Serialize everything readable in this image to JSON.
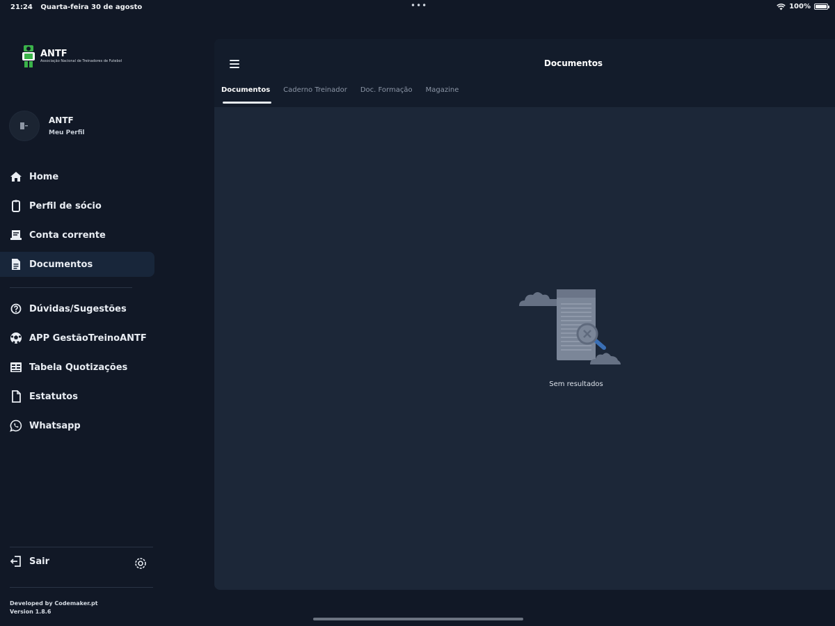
{
  "status_bar": {
    "time": "21:24",
    "date": "Quarta-feira 30 de agosto",
    "dots": "•••",
    "battery_pct": "100%",
    "icons": [
      "wifi-icon",
      "battery-icon"
    ]
  },
  "sidebar": {
    "logo": {
      "title": "ANTF",
      "subtitle": "Associação Nacional de Treinadores de Futebol"
    },
    "profile": {
      "name": "ANTF",
      "link": "Meu Perfil"
    },
    "menu": [
      {
        "label": "Home",
        "icon": "home-icon",
        "active": false
      },
      {
        "label": "Perfil de sócio",
        "icon": "member-card-icon",
        "active": false
      },
      {
        "label": "Conta corrente",
        "icon": "receipt-icon",
        "active": false
      },
      {
        "label": "Documentos",
        "icon": "document-icon",
        "active": true
      }
    ],
    "menu2": [
      {
        "label": "Dúvidas/Sugestões",
        "icon": "help-icon"
      },
      {
        "label": "APP GestãoTreinoANTF",
        "icon": "soccer-ball-icon"
      },
      {
        "label": "Tabela Quotizações",
        "icon": "table-icon"
      },
      {
        "label": "Estatutos",
        "icon": "file-icon"
      },
      {
        "label": "Whatsapp",
        "icon": "whatsapp-icon"
      }
    ],
    "logout_label": "Sair",
    "developer": "Developed by Codemaker.pt",
    "version": "Version 1.8.6"
  },
  "main": {
    "title": "Documentos",
    "tabs": [
      {
        "label": "Documentos",
        "active": true
      },
      {
        "label": "Caderno Treinador",
        "active": false
      },
      {
        "label": "Doc. Formação",
        "active": false
      },
      {
        "label": "Magazine",
        "active": false
      }
    ],
    "empty_state": "Sem resultados"
  },
  "colors": {
    "background": "#111826",
    "panel": "#1c2738",
    "topbar": "#131c2b",
    "active_item": "#18263a",
    "accent_green": "#3bb34a"
  }
}
